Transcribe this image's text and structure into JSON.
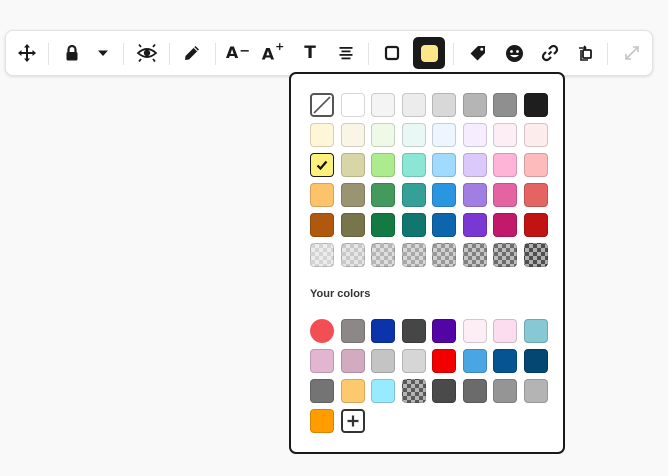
{
  "toolbar": {
    "buttons": [
      {
        "name": "move-button",
        "icon": "move-arrows-icon"
      },
      {
        "name": "lock-button",
        "icon": "lock-icon"
      },
      {
        "name": "lock-dropdown-button",
        "icon": "caret-down-icon"
      },
      {
        "name": "visibility-button",
        "icon": "eye-icon"
      },
      {
        "name": "pen-button",
        "icon": "pen-icon"
      },
      {
        "name": "decrease-font-button",
        "icon": "decrease-font-icon",
        "label": "A",
        "suffix": "−"
      },
      {
        "name": "increase-font-button",
        "icon": "increase-font-icon",
        "label": "A",
        "suffix": "+"
      },
      {
        "name": "text-format-button",
        "icon": "text-icon",
        "label": "T"
      },
      {
        "name": "align-button",
        "icon": "align-center-icon"
      },
      {
        "name": "border-color-button",
        "icon": "square-outline-icon"
      },
      {
        "name": "fill-color-button",
        "icon": "fill-swatch-icon",
        "color": "#fde68a"
      },
      {
        "name": "tag-button",
        "icon": "tag-icon"
      },
      {
        "name": "emoji-button",
        "icon": "smiley-icon"
      },
      {
        "name": "link-button",
        "icon": "link-icon"
      },
      {
        "name": "frame-button",
        "icon": "frame-swap-icon"
      },
      {
        "name": "expand-button",
        "icon": "expand-icon"
      }
    ]
  },
  "palette": {
    "selected_color": "#fdf07a",
    "preset_colors": [
      "none",
      "#ffffff",
      "#f4f4f4",
      "#ececec",
      "#d8d8d8",
      "#b5b5b5",
      "#8f8f8f",
      "#1e1e1e",
      "#fff6d8",
      "#f9f6e6",
      "#eef9e8",
      "#e9f8f4",
      "#edf6ff",
      "#f6eefe",
      "#fdeef6",
      "#fdecec",
      "#fdf07a",
      "#d8d6a6",
      "#acec8f",
      "#8ce6d6",
      "#a0dafd",
      "#dcc9fc",
      "#fdb4d6",
      "#fdbbbb",
      "#fdc36b",
      "#9a9472",
      "#439a5c",
      "#35a098",
      "#2a96e2",
      "#a07ee2",
      "#e464a2",
      "#e46464",
      "#b0590e",
      "#78744c",
      "#137a43",
      "#107670",
      "#0d65ac",
      "#7a37d2",
      "#c2196a",
      "#c21313",
      "checker:#d4d4d4",
      "checker:#c8c8c8",
      "checker:#b6b6b6",
      "checker:#a8a8a8",
      "checker:#989898",
      "checker:#808080",
      "checker:#6c6c6c",
      "checker:#4e4e4e"
    ],
    "custom_label": "Your colors",
    "custom_colors": [
      "round:#f24f54",
      "#8c8888",
      "#0b33aa",
      "#464646",
      "#5304a5",
      "#fdeef6",
      "#fcdcef",
      "#86c9d4",
      "#e3b5d1",
      "#d3abc1",
      "#c4c4c4",
      "#d6d6d6",
      "#f20000",
      "#4aa6e2",
      "#065592",
      "#034772",
      "#747474",
      "#fdc96e",
      "#98eaff",
      "checker:#5a5a5a",
      "#4a4a4a",
      "#6b6b6b",
      "#959595",
      "#b4b4b4",
      "#ff9d00"
    ],
    "add_button_icon": "plus-icon"
  }
}
